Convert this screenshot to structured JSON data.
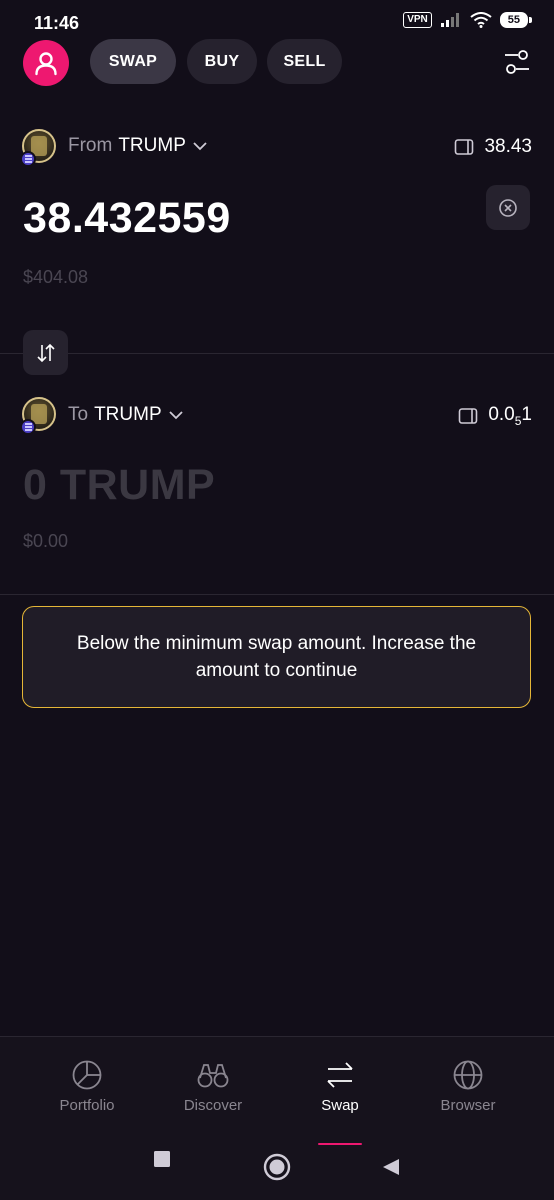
{
  "status_bar": {
    "time": "11:46",
    "vpn": "VPN",
    "battery": "55",
    "icons": [
      "signal-icon",
      "wifi-icon",
      "battery-icon"
    ]
  },
  "header": {
    "tabs": [
      {
        "label": "SWAP",
        "active": true
      },
      {
        "label": "BUY",
        "active": false
      },
      {
        "label": "SELL",
        "active": false
      }
    ],
    "icons": [
      "user-icon",
      "settings-sliders-icon"
    ]
  },
  "from": {
    "prefix": "From",
    "token": "TRUMP",
    "balance": "38.43",
    "amount": "38.432559",
    "fiat": "$404.08"
  },
  "to": {
    "prefix": "To",
    "token": "TRUMP",
    "balance_main": "0.0",
    "balance_sub": "5",
    "balance_tail": "1",
    "amount": "0 TRUMP",
    "fiat": "$0.00"
  },
  "warning": {
    "text": "Below the minimum swap amount. Increase the amount to continue",
    "color": "#e5b637"
  },
  "bottom_nav": {
    "items": [
      {
        "label": "Portfolio",
        "icon": "pie-chart-icon",
        "active": false
      },
      {
        "label": "Discover",
        "icon": "binoculars-icon",
        "active": false
      },
      {
        "label": "Swap",
        "icon": "swap-arrows-icon",
        "active": true
      },
      {
        "label": "Browser",
        "icon": "globe-icon",
        "active": false
      }
    ]
  },
  "colors": {
    "background": "#120e19",
    "accent": "#ee1870",
    "surface": "#26222e"
  }
}
